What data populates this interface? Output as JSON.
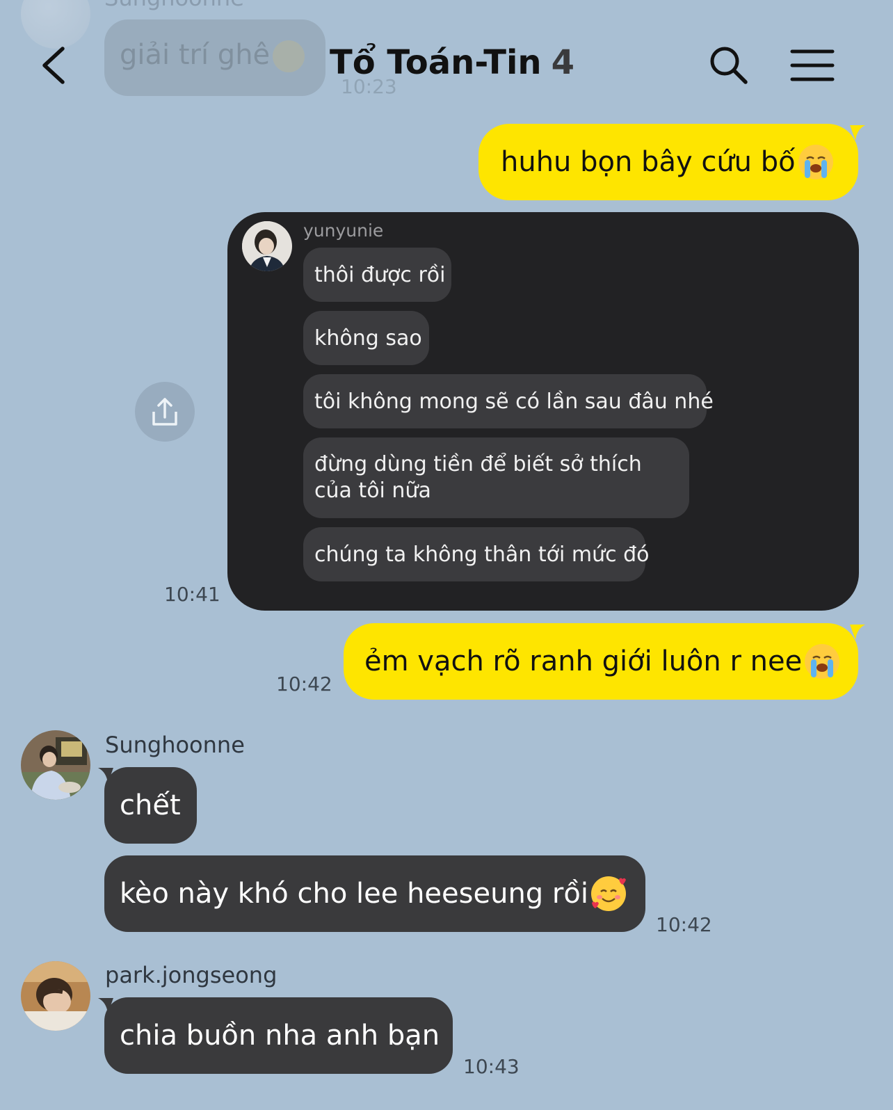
{
  "header": {
    "title": "Tổ Toán-Tin",
    "member_count": "4",
    "back_icon": "chevron-left-icon",
    "search_icon": "search-icon",
    "menu_icon": "menu-icon"
  },
  "previous_message": {
    "sender": "Sunghoonne",
    "text": "giải trí ghê",
    "time": "10:23"
  },
  "messages": [
    {
      "id": "m1",
      "type": "outgoing",
      "text": "huhu bọn bây cứu bố",
      "emoji": "loudly-crying-face"
    },
    {
      "id": "m2",
      "type": "outgoing-screenshot",
      "time": "10:41",
      "screenshot": {
        "sender": "yunyunie",
        "lines": [
          "thôi được rồi",
          "không sao",
          "tôi không mong sẽ có lần sau đâu nhé",
          "đừng dùng tiền để biết sở thích của tôi nữa",
          "chúng ta không thân tới mức đó"
        ]
      },
      "share_icon": "share-icon"
    },
    {
      "id": "m3",
      "type": "outgoing",
      "text": "ẻm vạch rõ ranh giới luôn r nee",
      "emoji": "loudly-crying-face",
      "time": "10:42"
    },
    {
      "id": "m4",
      "type": "incoming",
      "sender": "Sunghoonne",
      "bubbles": [
        "chết",
        "kèo này khó cho lee heeseung rồi"
      ],
      "emoji": "smiling-face-with-hearts",
      "time": "10:42"
    },
    {
      "id": "m5",
      "type": "incoming",
      "sender": "park.jongseong",
      "bubbles": [
        "chia buồn nha anh bạn"
      ],
      "time": "10:43"
    }
  ],
  "colors": {
    "background": "#a9bfd3",
    "outgoing_bubble": "#fee500",
    "incoming_bubble": "#3a3a3c",
    "screenshot_card": "#222224"
  }
}
